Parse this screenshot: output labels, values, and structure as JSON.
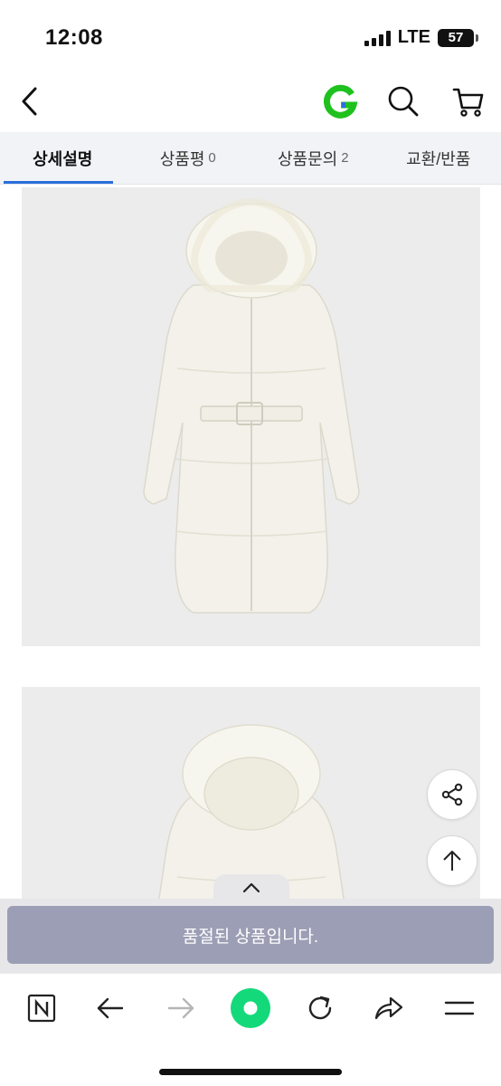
{
  "status_bar": {
    "time": "12:08",
    "network": "LTE",
    "battery": "57"
  },
  "header": {
    "back_icon": "chevron-left-icon",
    "logo_letter": "G",
    "logo_color": "#1ec11e",
    "search_icon": "search-icon",
    "cart_icon": "cart-icon"
  },
  "tabs": [
    {
      "label": "상세설명",
      "count": "",
      "active": true
    },
    {
      "label": "상품평",
      "count": "0",
      "active": false
    },
    {
      "label": "상품문의",
      "count": "2",
      "active": false
    },
    {
      "label": "교환/반품",
      "count": "",
      "active": false
    }
  ],
  "content": {
    "images": [
      "coat-front-image",
      "coat-back-image"
    ],
    "share_icon": "share-icon",
    "scroll_top_icon": "arrow-up-icon"
  },
  "soldout": {
    "panel_toggle_icon": "chevron-up-icon",
    "message": "품절된 상품입니다."
  },
  "browser_bar": {
    "items": [
      "n-icon",
      "back-arrow-icon",
      "forward-arrow-icon",
      "home-dot-icon",
      "refresh-icon",
      "share-arrow-icon",
      "menu-icon"
    ]
  },
  "colors": {
    "accent": "#2a6fdb",
    "soldout_bg": "#9c9eb5",
    "tab_bg": "#f1f3f6",
    "browser_home": "#14d97a"
  }
}
